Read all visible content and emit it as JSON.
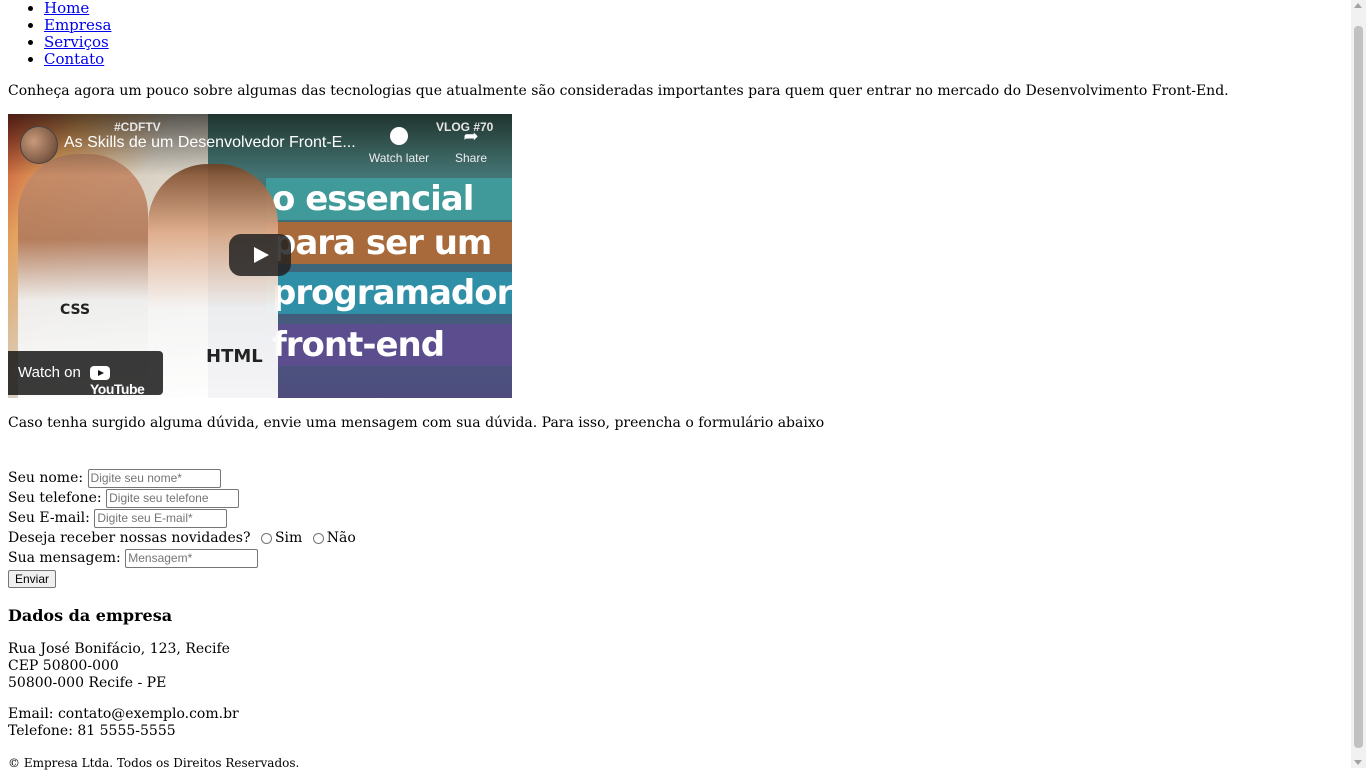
{
  "nav": {
    "items": [
      {
        "label": "Home"
      },
      {
        "label": "Empresa"
      },
      {
        "label": "Serviços"
      },
      {
        "label": "Contato"
      }
    ]
  },
  "intro": "Conheça agora um pouco sobre algumas das tecnologias que atualmente são consideradas importantes para quem quer entrar no mercado do Desenvolvimento Front-End.",
  "video": {
    "title": "As Skills de um Desenvolvedor Front-E...",
    "tag_left": "#CDFTV",
    "tag_right": "VLOG #70",
    "watch_later": "Watch later",
    "share": "Share",
    "thumb_lines": [
      "o essencial",
      "para ser um",
      "programador",
      "front-end"
    ],
    "watch_on": "Watch on",
    "youtube": "YouTube",
    "badge_css": "CSS",
    "badge_html": "HTML"
  },
  "duvida": "Caso tenha surgido alguma dúvida, envie uma mensagem com sua dúvida. Para isso, preencha o formulário abaixo",
  "form": {
    "name_label": "Seu nome:",
    "name_placeholder": "Digite seu nome*",
    "tel_label": "Seu telefone:",
    "tel_placeholder": "Digite seu telefone",
    "email_label": "Seu E-mail:",
    "email_placeholder": "Digite seu E-mail*",
    "news_label": "Deseja receber nossas novidades?",
    "opt_yes": "Sim",
    "opt_no": "Não",
    "msg_label": "Sua mensagem:",
    "msg_placeholder": "Mensagem*",
    "submit": "Enviar"
  },
  "company": {
    "heading": "Dados da empresa",
    "address_line1": "Rua José Bonifácio, 123, Recife",
    "address_line2": "CEP 50800-000",
    "address_line3": "50800-000 Recife - PE",
    "email": "Email: contato@exemplo.com.br",
    "phone": "Telefone: 81 5555-5555"
  },
  "footer": "© Empresa Ltda. Todos os Direitos Reservados."
}
